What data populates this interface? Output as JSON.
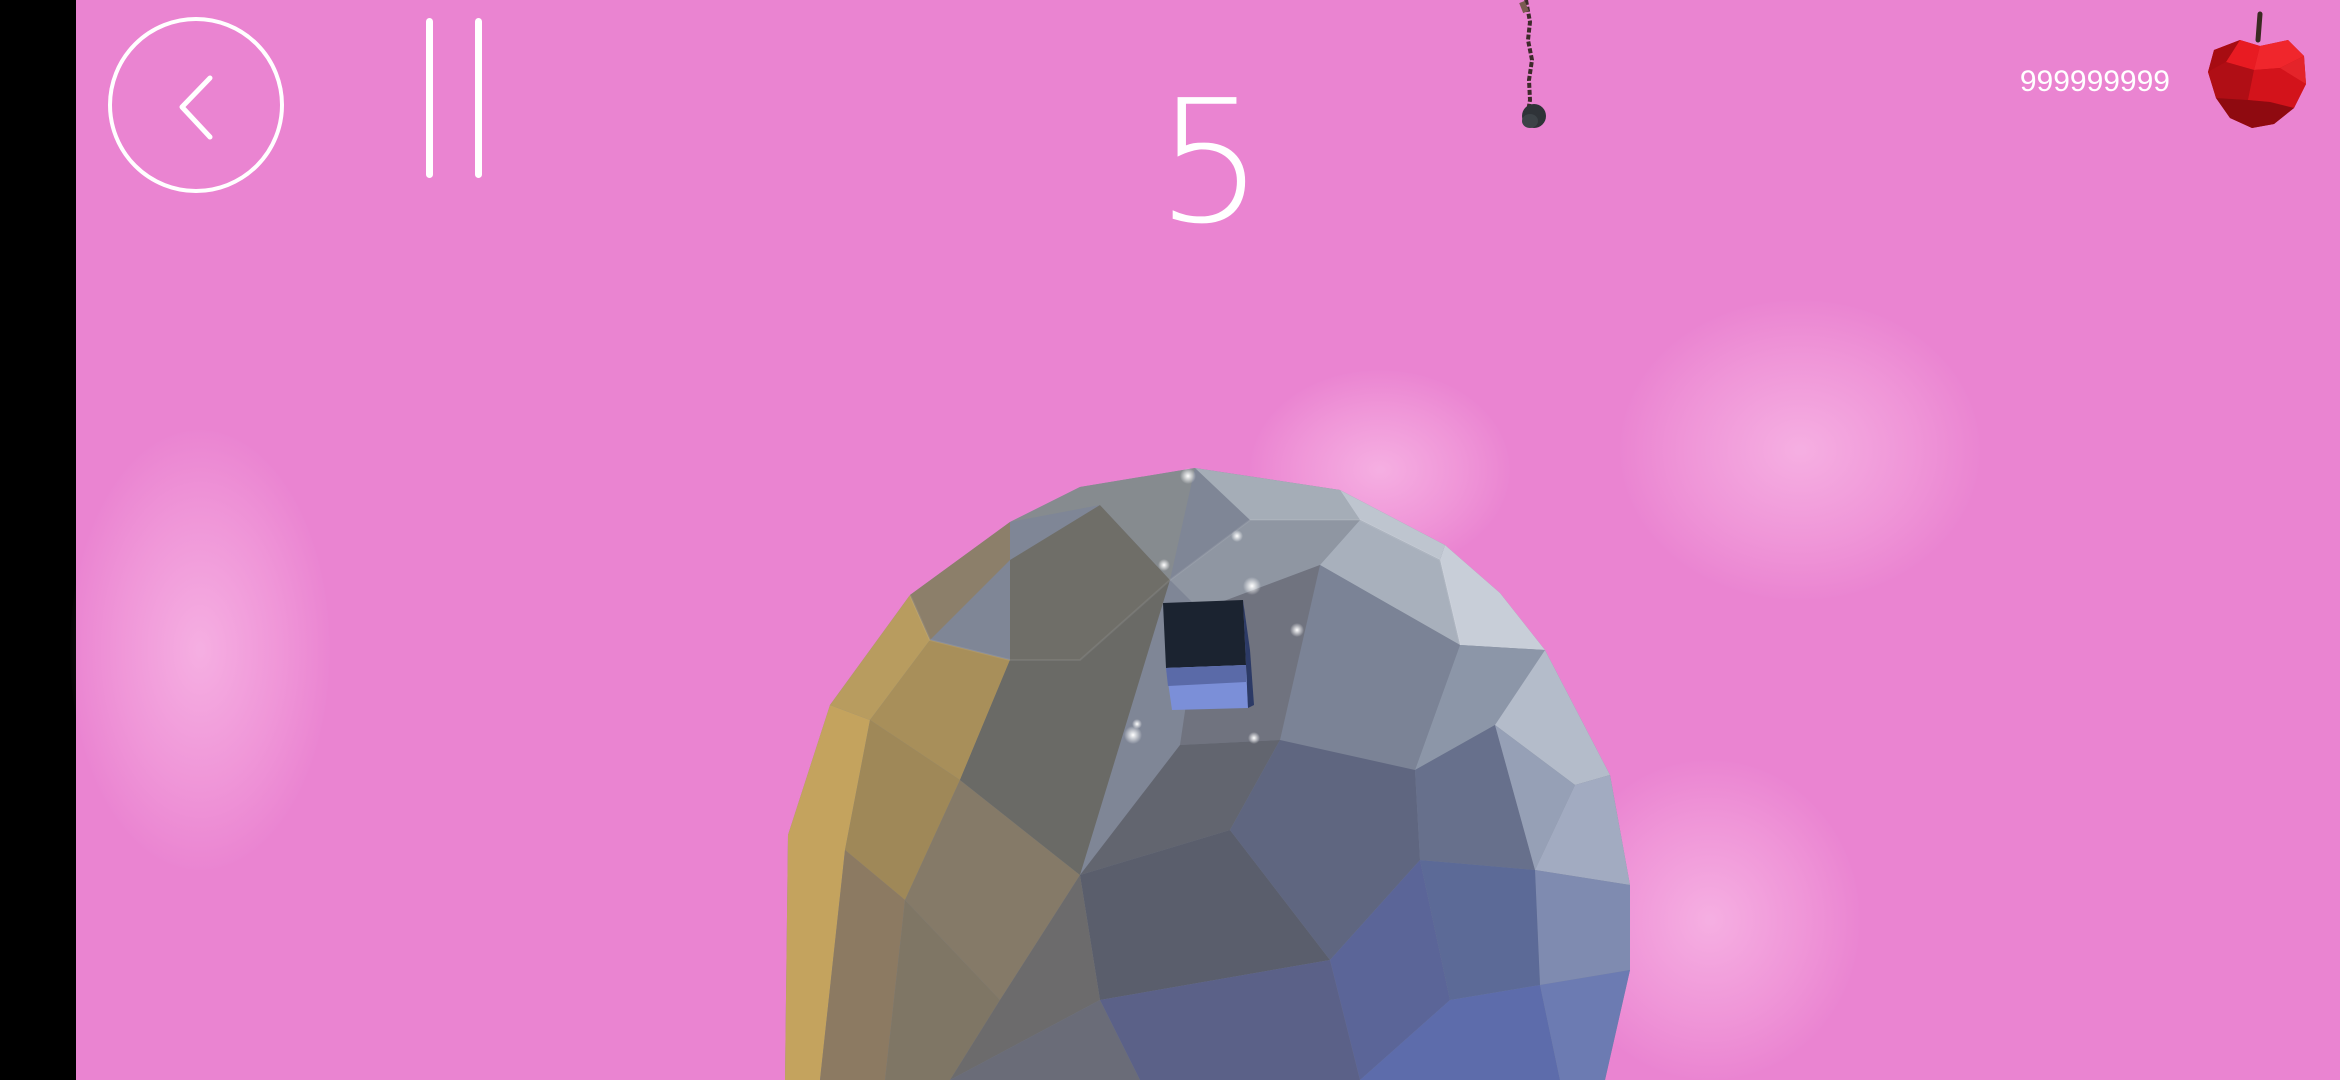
{
  "hud": {
    "score": "5",
    "apple_count": "999999999"
  },
  "icons": {
    "back": "chevron-left-icon",
    "pause": "pause-icon",
    "currency": "red-apple-icon",
    "hazard": "hanging-chain-icon"
  },
  "colors": {
    "sky": "#ea84d1",
    "hud_text": "#ffffff",
    "apple": "#d4111a",
    "player_cube_top": "#1b2330",
    "player_cube_side": "#7b8fd8"
  }
}
